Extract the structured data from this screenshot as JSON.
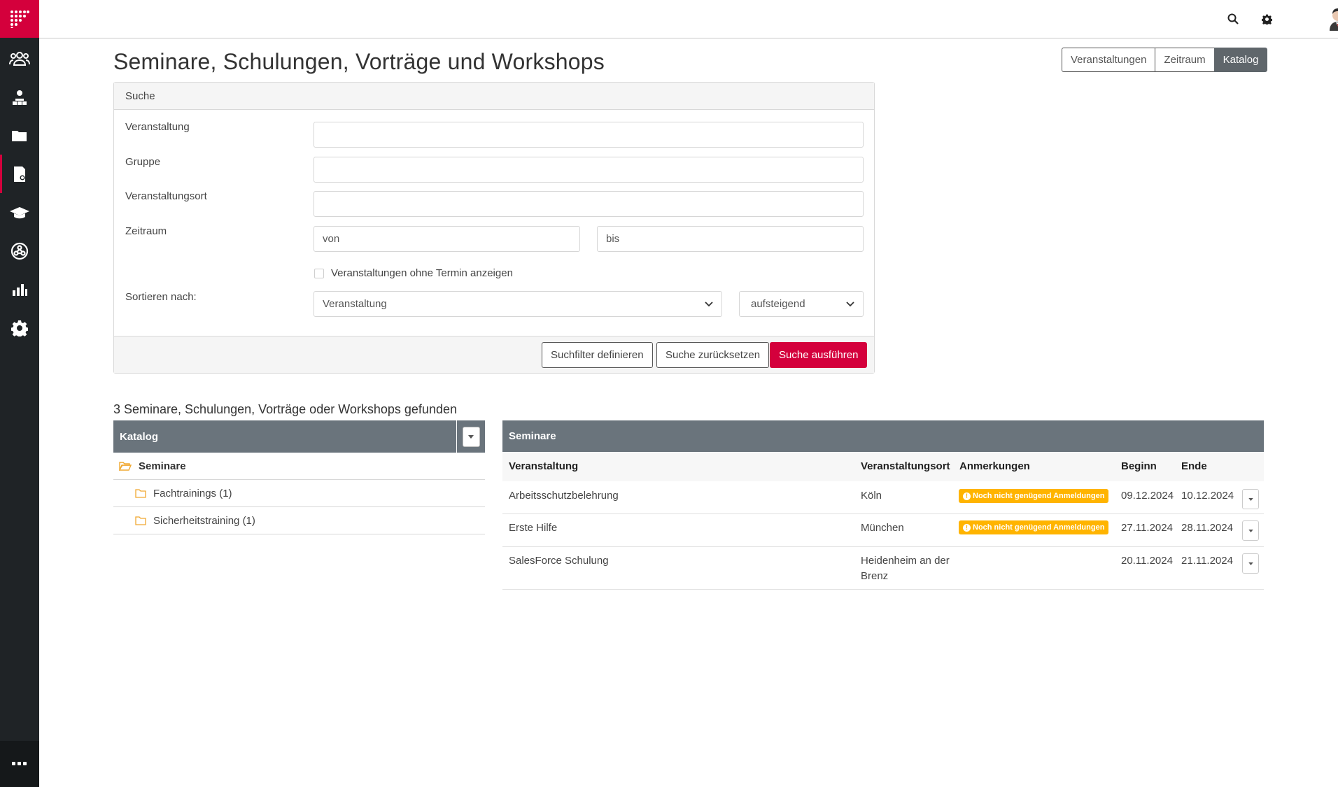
{
  "brand_color": "#d4003c",
  "sidebar": {
    "items": [
      {
        "name": "users-group-icon"
      },
      {
        "name": "org-chart-icon"
      },
      {
        "name": "folder-icon"
      },
      {
        "name": "document-badge-icon"
      },
      {
        "name": "graduation-cap-icon"
      },
      {
        "name": "network-icon"
      },
      {
        "name": "bar-chart-icon"
      },
      {
        "name": "gear-icon"
      }
    ],
    "more_icon": "ellipsis-icon"
  },
  "header": {
    "title": "Seminare, Schulungen, Vorträge und Workshops",
    "view_tabs": [
      {
        "label": "Veranstaltungen",
        "active": false
      },
      {
        "label": "Zeitraum",
        "active": false
      },
      {
        "label": "Katalog",
        "active": true
      }
    ]
  },
  "search": {
    "panel_title": "Suche",
    "fields": {
      "veranstaltung": {
        "label": "Veranstaltung",
        "value": ""
      },
      "gruppe": {
        "label": "Gruppe",
        "value": ""
      },
      "ort": {
        "label": "Veranstaltungsort",
        "value": ""
      },
      "zeitraum": {
        "label": "Zeitraum",
        "von_placeholder": "von",
        "bis_placeholder": "bis"
      }
    },
    "checkbox_label": "Veranstaltungen ohne Termin anzeigen",
    "sort_label": "Sortieren nach:",
    "sort_field": "Veranstaltung",
    "sort_order": "aufsteigend",
    "buttons": {
      "define_filter": "Suchfilter definieren",
      "reset": "Suche zurücksetzen",
      "execute": "Suche ausführen"
    }
  },
  "results": {
    "heading": "3 Seminare, Schulungen, Vorträge oder Workshops gefunden"
  },
  "catalog": {
    "title": "Katalog",
    "root": "Seminare",
    "children": [
      "Fachtrainings (1)",
      "Sicherheitstraining (1)"
    ]
  },
  "seminare": {
    "title": "Seminare",
    "columns": [
      "Veranstaltung",
      "Veranstaltungsort",
      "Anmerkungen",
      "Beginn",
      "Ende"
    ],
    "rows": [
      {
        "veranstaltung": "Arbeitsschutzbelehrung",
        "ort": "Köln",
        "ort2": "",
        "anmerkung": "Noch nicht genügend Anmeldungen",
        "beginn": "09.12.2024",
        "ende": "10.12.2024"
      },
      {
        "veranstaltung": "Erste Hilfe",
        "ort": "München",
        "ort2": "",
        "anmerkung": "Noch nicht genügend Anmeldungen",
        "beginn": "27.11.2024",
        "ende": "28.11.2024"
      },
      {
        "veranstaltung": "SalesForce Schulung",
        "ort": "Heidenheim an der",
        "ort2": "Brenz",
        "anmerkung": "",
        "beginn": "20.11.2024",
        "ende": "21.11.2024"
      }
    ]
  }
}
